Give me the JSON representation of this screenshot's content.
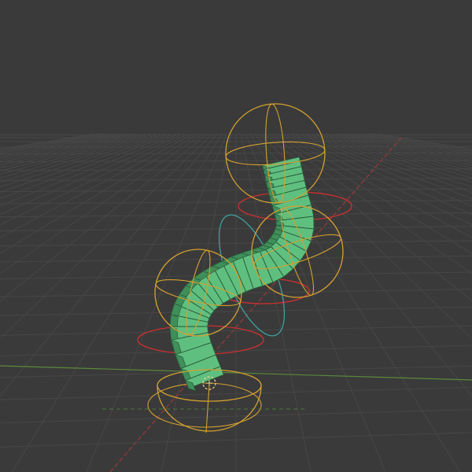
{
  "viewport": {
    "name": "3d-viewport",
    "background": "#3a3a3a",
    "grid_color": "#474747",
    "axis_x_color": "#9b3a3a",
    "axis_y_color": "#5a8a3a"
  },
  "scene": {
    "object": {
      "name": "bent-tube-mesh",
      "segments": 32,
      "face_color": "#5fbf7f",
      "side_color": "#3f8f5a",
      "edge_color": "#2a5a3a"
    },
    "rig": {
      "rotation_gizmo_color": "#d4a030",
      "ring_red_color": "#cc3030",
      "ring_teal_color": "#40a0a0",
      "controls": [
        "top-control",
        "upper-mid-control",
        "lower-mid-control",
        "base-control"
      ]
    },
    "origin_marker": {
      "name": "object-origin",
      "color": "#e8d890"
    }
  }
}
